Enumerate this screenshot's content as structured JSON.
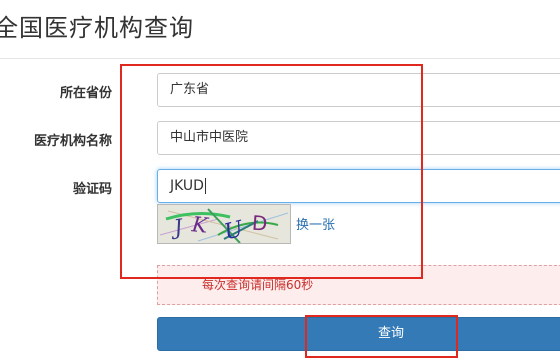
{
  "page": {
    "title": "全国医疗机构查询"
  },
  "form": {
    "province_label": "所在省份",
    "province_value": "广东省",
    "hospital_label": "医疗机构名称",
    "hospital_value": "中山市中医院",
    "captcha_label": "验证码",
    "captcha_value": "JKUD",
    "captcha_image_text": "JKUD",
    "refresh_label": "换一张",
    "alert_message": "每次查询请间隔60秒",
    "submit_label": "查询"
  },
  "colors": {
    "primary_button": "#337ab7",
    "alert_text": "#c9302c",
    "alert_bg": "#fdeded",
    "annotation_border": "#e0281e",
    "link": "#2a6fb0"
  }
}
